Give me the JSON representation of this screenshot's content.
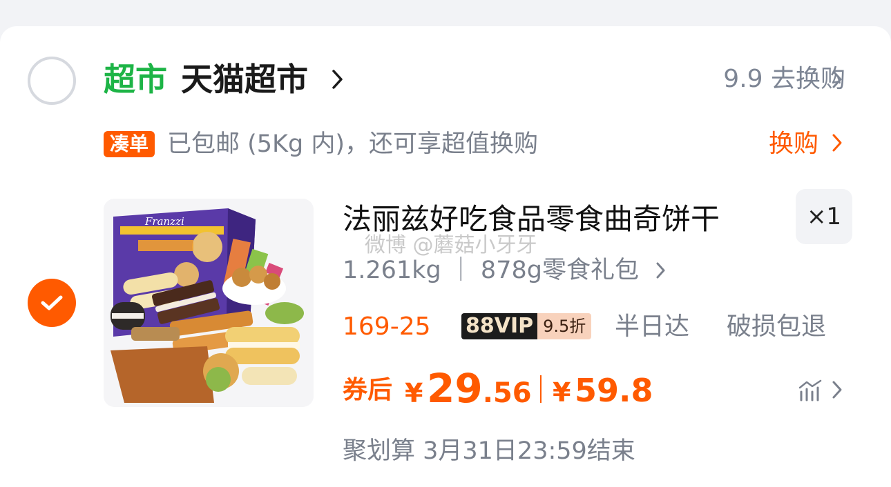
{
  "store": {
    "brand_label": "超市",
    "name": "天猫超市",
    "brand_color": "#1db446",
    "exchange_link": "9.9 去换购"
  },
  "shipping": {
    "badge": "凑单",
    "text": "已包邮 (5Kg 内)，还可享超值换购",
    "link": "换购"
  },
  "item": {
    "title": "法丽兹好吃食品零食曲奇饼干",
    "quantity": "×1",
    "sku": "1.261kg ｜ 878g零食礼包",
    "promo": "169-25",
    "vip_label": "88VIP",
    "vip_discount": "9.5折",
    "tags": [
      "半日达",
      "破损包退"
    ],
    "price_label": "券后",
    "currency": "¥",
    "price_int": "29",
    "price_dec": ".56",
    "original_price": "59.8",
    "deal_text": "聚划算 3月31日23:59结束",
    "image_brand": "Franzzi",
    "checked": true
  },
  "watermark": "微博 @蘑菇小牙牙",
  "colors": {
    "accent": "#ff5a00",
    "muted": "#7a808c",
    "background": "#f2f3f6"
  }
}
